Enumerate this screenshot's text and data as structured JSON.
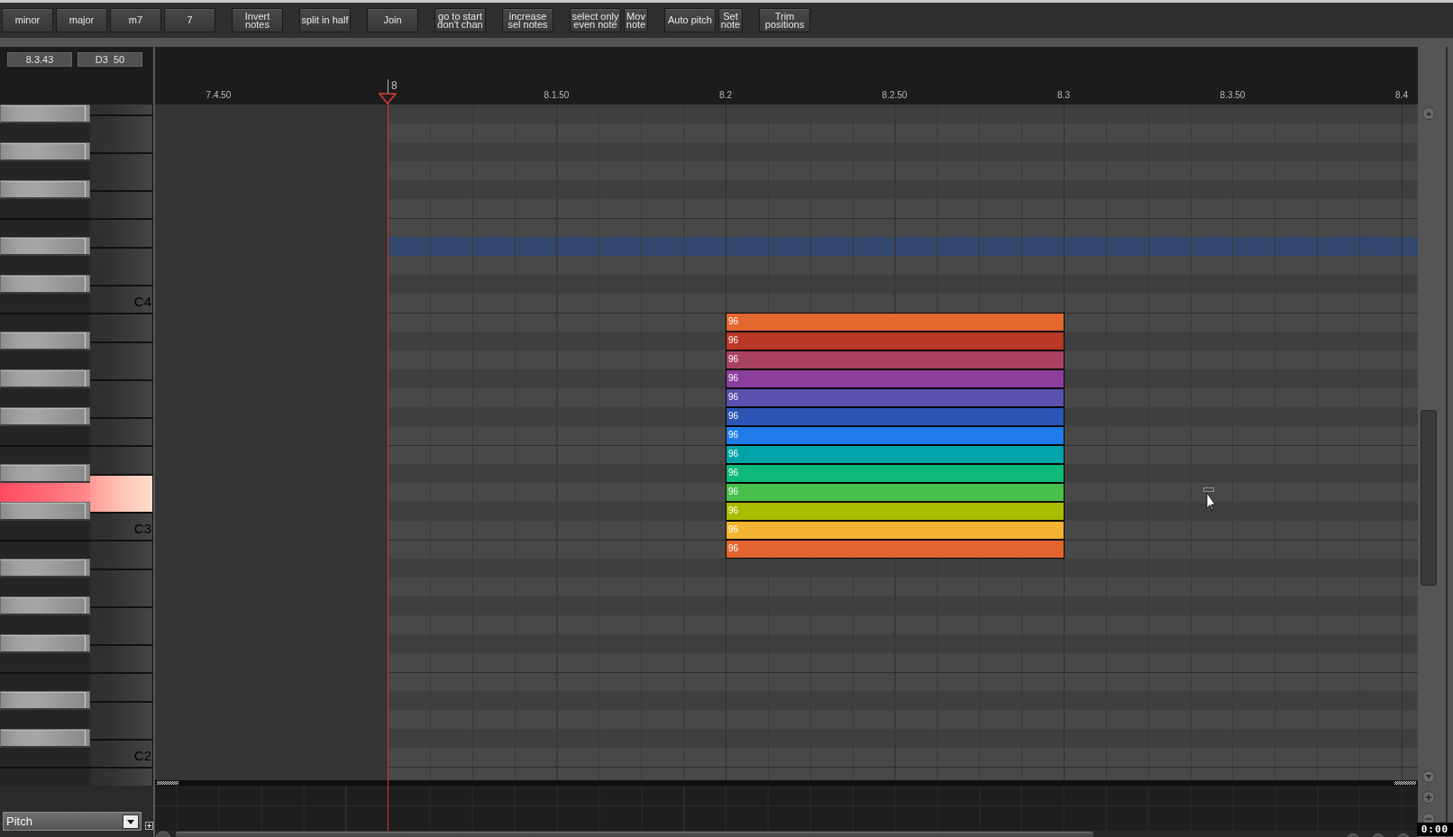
{
  "toolbar": {
    "groups": [
      {
        "buttons": [
          {
            "label": "minor",
            "kind": "regular"
          },
          {
            "label": "major",
            "kind": "regular"
          },
          {
            "label": "m7",
            "kind": "regular"
          },
          {
            "label": "7",
            "kind": "regular"
          }
        ]
      },
      {
        "buttons": [
          {
            "label": "Invert\nnotes",
            "kind": "regular"
          }
        ]
      },
      {
        "buttons": [
          {
            "label": "split in half",
            "kind": "regular"
          }
        ]
      },
      {
        "buttons": [
          {
            "label": "Join",
            "kind": "regular"
          }
        ]
      },
      {
        "buttons": [
          {
            "label": "go to start\ndon't chan",
            "kind": "regular"
          }
        ]
      },
      {
        "buttons": [
          {
            "label": "increase\nsel notes",
            "kind": "regular"
          }
        ]
      },
      {
        "buttons": [
          {
            "label": "select only\neven note",
            "kind": "regular"
          },
          {
            "label": "Mov\nnote",
            "kind": "compact"
          }
        ]
      },
      {
        "buttons": [
          {
            "label": "Auto pitch",
            "kind": "regular"
          },
          {
            "label": "Set\nnote",
            "kind": "compact"
          }
        ]
      },
      {
        "buttons": [
          {
            "label": "Trim\npositions",
            "kind": "regular"
          }
        ]
      }
    ]
  },
  "readouts": [
    {
      "value": "8.3.43"
    },
    {
      "value": "D3  50"
    }
  ],
  "ruler": {
    "labels": [
      {
        "text": "7.4.50",
        "kind": "tick"
      },
      {
        "text": "8",
        "kind": "marker"
      },
      {
        "text": "8.1.50",
        "kind": "tick"
      },
      {
        "text": "8.2",
        "kind": "tick"
      },
      {
        "text": "8.2.50",
        "kind": "tick"
      },
      {
        "text": "8.3",
        "kind": "tick"
      },
      {
        "text": "8.3.50",
        "kind": "tick"
      },
      {
        "text": "8.4",
        "kind": "tick"
      }
    ]
  },
  "pitch_rows": [
    {
      "kind": "black",
      "selected": false,
      "highlighted": false
    },
    {
      "kind": "white",
      "selected": false,
      "highlighted": false
    },
    {
      "kind": "black",
      "selected": false,
      "highlighted": false
    },
    {
      "kind": "white",
      "selected": false,
      "highlighted": false
    },
    {
      "kind": "black",
      "selected": false,
      "highlighted": false
    },
    {
      "kind": "white",
      "selected": false,
      "highlighted": false
    },
    {
      "kind": "white",
      "selected": false,
      "highlighted": false
    },
    {
      "kind": "black",
      "selected": false,
      "highlighted": true
    },
    {
      "kind": "white",
      "selected": false,
      "highlighted": false
    },
    {
      "kind": "black",
      "selected": false,
      "highlighted": false
    },
    {
      "kind": "white",
      "label": "C4",
      "selected": false,
      "highlighted": false
    },
    {
      "kind": "white",
      "selected": false,
      "highlighted": false
    },
    {
      "kind": "black",
      "selected": false,
      "highlighted": false
    },
    {
      "kind": "white",
      "selected": false,
      "highlighted": false
    },
    {
      "kind": "black",
      "selected": false,
      "highlighted": false
    },
    {
      "kind": "white",
      "selected": false,
      "highlighted": false
    },
    {
      "kind": "black",
      "selected": false,
      "highlighted": false
    },
    {
      "kind": "white",
      "selected": false,
      "highlighted": false
    },
    {
      "kind": "white",
      "selected": false,
      "highlighted": false
    },
    {
      "kind": "black",
      "selected": false,
      "highlighted": false
    },
    {
      "kind": "white",
      "selected": true,
      "highlighted": false
    },
    {
      "kind": "black",
      "selected": false,
      "highlighted": false
    },
    {
      "kind": "white",
      "label": "C3",
      "selected": false,
      "highlighted": false
    },
    {
      "kind": "white",
      "selected": false,
      "highlighted": false
    },
    {
      "kind": "black",
      "selected": false,
      "highlighted": false
    },
    {
      "kind": "white",
      "selected": false,
      "highlighted": false
    },
    {
      "kind": "black",
      "selected": false,
      "highlighted": false
    },
    {
      "kind": "white",
      "selected": false,
      "highlighted": false
    },
    {
      "kind": "black",
      "selected": false,
      "highlighted": false
    },
    {
      "kind": "white",
      "selected": false,
      "highlighted": false
    },
    {
      "kind": "white",
      "selected": false,
      "highlighted": false
    },
    {
      "kind": "black",
      "selected": false,
      "highlighted": false
    },
    {
      "kind": "white",
      "selected": false,
      "highlighted": false
    },
    {
      "kind": "black",
      "selected": false,
      "highlighted": false
    },
    {
      "kind": "white",
      "label": "C2",
      "selected": false,
      "highlighted": false
    },
    {
      "kind": "white",
      "selected": false,
      "highlighted": false
    }
  ],
  "notes": [
    {
      "velocity": "96",
      "color": "#e3672f"
    },
    {
      "velocity": "96",
      "color": "#b93826"
    },
    {
      "velocity": "96",
      "color": "#a84260"
    },
    {
      "velocity": "96",
      "color": "#8b3e9c"
    },
    {
      "velocity": "96",
      "color": "#5a50ad"
    },
    {
      "velocity": "96",
      "color": "#2d55b5"
    },
    {
      "velocity": "96",
      "color": "#1f7ce9"
    },
    {
      "velocity": "96",
      "color": "#00a4a8"
    },
    {
      "velocity": "96",
      "color": "#0eb979"
    },
    {
      "velocity": "96",
      "color": "#49bf4b"
    },
    {
      "velocity": "96",
      "color": "#a8bc00"
    },
    {
      "velocity": "96",
      "color": "#f2b432"
    },
    {
      "velocity": "96",
      "color": "#e2652f"
    }
  ],
  "lane": {
    "parameter": "Pitch"
  },
  "time_display": "0:00"
}
